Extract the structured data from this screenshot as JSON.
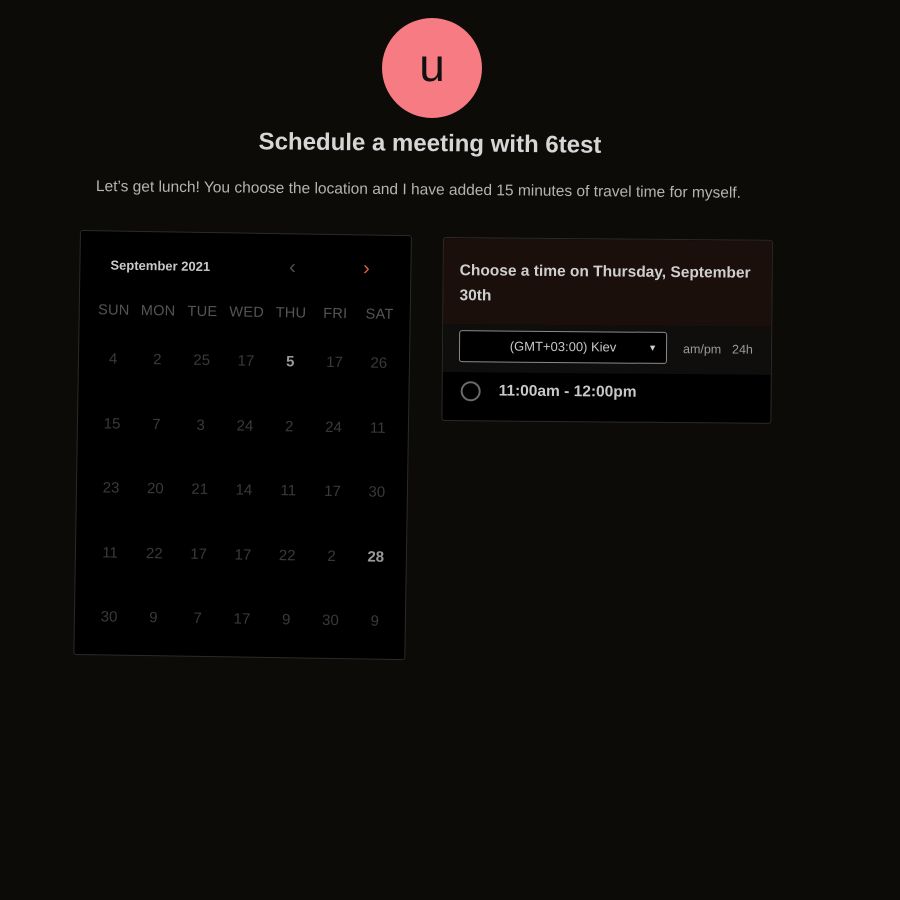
{
  "avatar": {
    "letter": "u"
  },
  "title": "Schedule a meeting with 6test",
  "subtitle": "Let’s get lunch! You choose the location and I have added 15 minutes of travel time for myself.",
  "calendar": {
    "month_label": "September 2021",
    "prev_icon": "chevron-left-icon",
    "next_icon": "chevron-right-icon",
    "weekdays": [
      "SUN",
      "MON",
      "TUE",
      "WED",
      "THU",
      "FRI",
      "SAT"
    ],
    "weeks": [
      [
        "4",
        "2",
        "25",
        "17",
        "5",
        "17",
        "26"
      ],
      [
        "15",
        "7",
        "3",
        "24",
        "2",
        "24",
        "11"
      ],
      [
        "23",
        "20",
        "21",
        "14",
        "11",
        "17",
        "30"
      ],
      [
        "11",
        "22",
        "17",
        "17",
        "22",
        "2",
        "28"
      ],
      [
        "30",
        "9",
        "7",
        "17",
        "9",
        "30",
        "9"
      ]
    ],
    "highlighted": [
      "5",
      "28"
    ],
    "colors": {
      "next_arrow": "#e0623c",
      "prev_arrow": "#4f4f4f"
    }
  },
  "time_panel": {
    "header": "Choose a time on Thursday, September 30th",
    "timezone_value": "(GMT+03:00) Kiev",
    "format_ampm": "am/pm",
    "format_24h": "24h",
    "slots": [
      "11:00am - 12:00pm"
    ]
  },
  "colors": {
    "avatar": "#f77b82",
    "background": "#0c0b08",
    "panel_header": "#1a0f0b"
  }
}
